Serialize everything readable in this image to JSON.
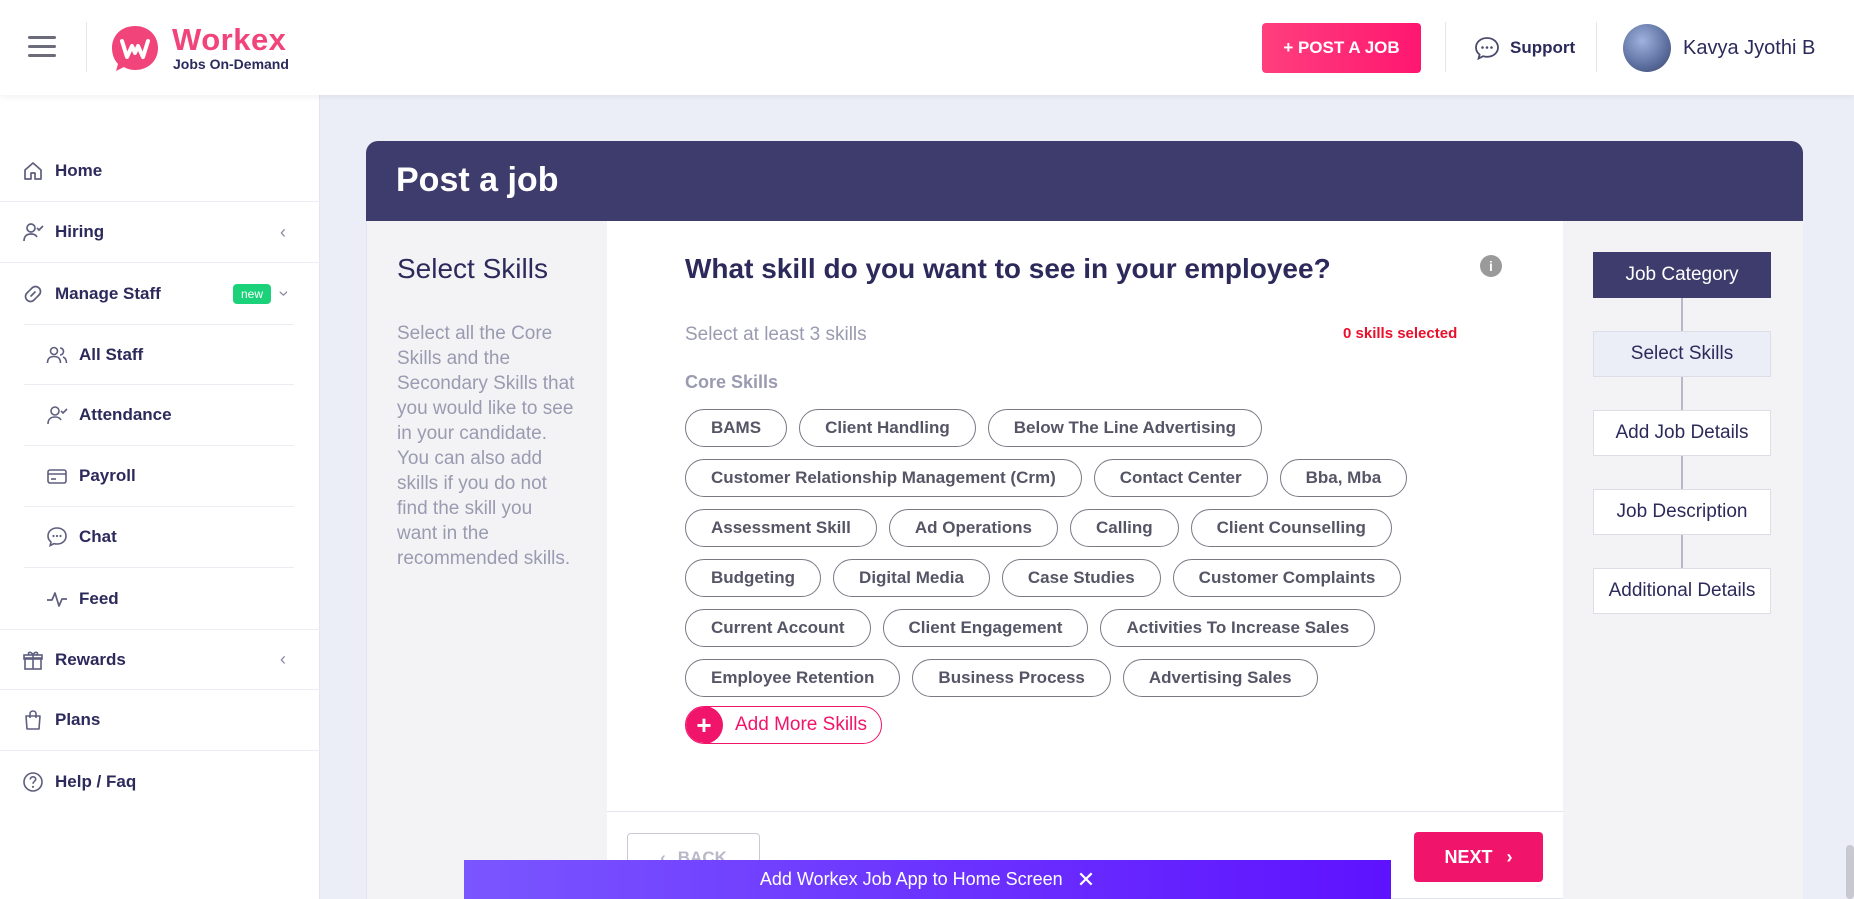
{
  "header": {
    "logo_name": "Workex",
    "logo_tagline": "Jobs On-Demand",
    "post_job_label": "+ POST A JOB",
    "support_label": "Support",
    "user_name": "Kavya Jyothi B"
  },
  "sidebar": {
    "items": [
      {
        "label": "Home",
        "icon": "home-icon"
      },
      {
        "label": "Hiring",
        "icon": "hiring-icon"
      },
      {
        "label": "Manage Staff",
        "icon": "link-icon",
        "badge": "new"
      },
      {
        "label": "All Staff",
        "icon": "staff-icon"
      },
      {
        "label": "Attendance",
        "icon": "attendance-icon"
      },
      {
        "label": "Payroll",
        "icon": "card-icon"
      },
      {
        "label": "Chat",
        "icon": "chat-icon"
      },
      {
        "label": "Feed",
        "icon": "pulse-icon"
      },
      {
        "label": "Rewards",
        "icon": "gift-icon"
      },
      {
        "label": "Plans",
        "icon": "bag-icon"
      },
      {
        "label": "Help / Faq",
        "icon": "help-icon"
      }
    ]
  },
  "page": {
    "title": "Post a job",
    "left_title": "Select Skills",
    "left_description": "Select all the Core Skills and the Secondary Skills that you would like to see in your candidate. You can also add skills if you do not find the skill you want in the recommended skills.",
    "question": "What skill do you want to see in your employee?",
    "hint": "Select at least 3 skills",
    "selected_count": "0 skills selected",
    "core_label": "Core Skills",
    "core_skills": [
      [
        "BAMS",
        "Client Handling",
        "Below The Line Advertising"
      ],
      [
        "Customer Relationship Management (Crm)",
        "Contact Center",
        "Bba, Mba"
      ],
      [
        "Assessment Skill",
        "Ad Operations",
        "Calling",
        "Client Counselling"
      ],
      [
        "Budgeting",
        "Digital Media",
        "Case Studies",
        "Customer Complaints"
      ],
      [
        "Current Account",
        "Client Engagement",
        "Activities To Increase Sales"
      ],
      [
        "Employee Retention",
        "Business Process",
        "Advertising Sales"
      ]
    ],
    "add_more_label": "Add More Skills",
    "back_label": "BACK",
    "next_label": "NEXT"
  },
  "steps": [
    "Job Category",
    "Select Skills",
    "Add Job Details",
    "Job Description",
    "Additional Details"
  ],
  "banner": {
    "text": "Add Workex Job App to Home Screen"
  },
  "colors": {
    "brand_pink": "#f1146b",
    "navy": "#3d3c6c",
    "badge_green": "#1bd27a",
    "alert_red": "#e8102c"
  }
}
